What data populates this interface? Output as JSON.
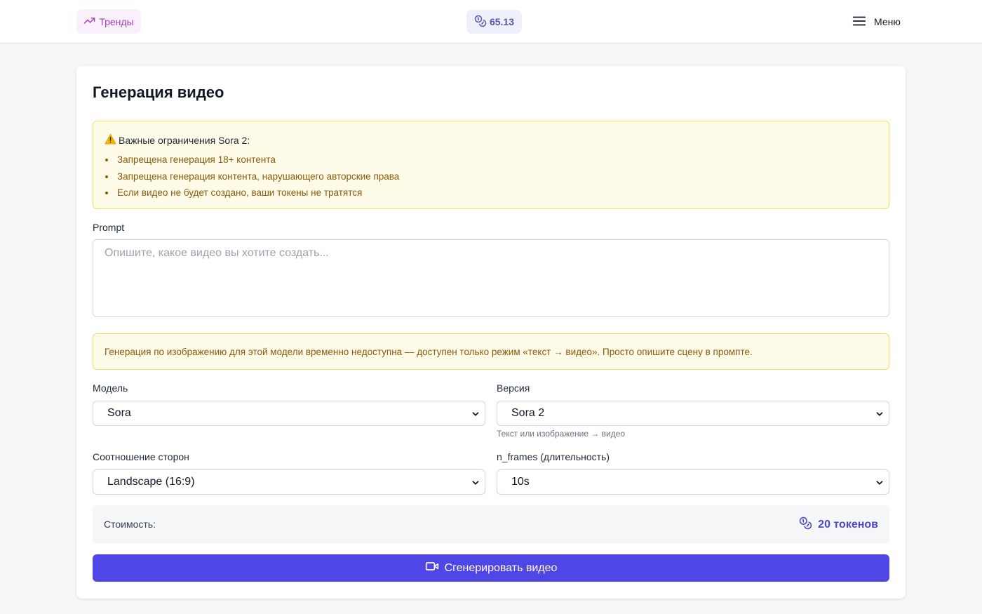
{
  "header": {
    "trends_label": "Тренды",
    "balance": "65.13",
    "menu_label": "Меню"
  },
  "page": {
    "title": "Генерация видео"
  },
  "warning": {
    "title": "Важные ограничения Sora 2:",
    "items": [
      "Запрещена генерация 18+ контента",
      "Запрещена генерация контента, нарушающего авторские права",
      "Если видео не будет создано, ваши токены не тратятся"
    ]
  },
  "prompt": {
    "label": "Prompt",
    "placeholder": "Опишите, какое видео вы хотите создать...",
    "value": ""
  },
  "info": {
    "text": "Генерация по изображению для этой модели временно недоступна — доступен только режим «текст → видео». Просто опишите сцену в промпте."
  },
  "model": {
    "label": "Модель",
    "selected": "Sora"
  },
  "version": {
    "label": "Версия",
    "selected": "Sora 2",
    "hint": "Текст или изображение → видео"
  },
  "aspect": {
    "label": "Соотношение сторон",
    "selected": "Landscape (16:9)"
  },
  "frames": {
    "label": "n_frames (длительность)",
    "selected": "10s"
  },
  "cost": {
    "label": "Стоимость:",
    "value": "20 токенов"
  },
  "generate": {
    "label": "Сгенерировать видео"
  },
  "colors": {
    "accent": "#4f46e5",
    "trends": "#a13fb8",
    "warning_bg": "#fefce8",
    "warning_text": "#8a5a0a"
  }
}
